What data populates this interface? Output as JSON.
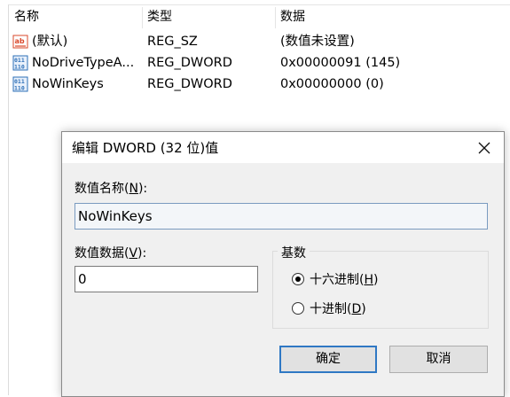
{
  "list": {
    "columns": [
      "名称",
      "类型",
      "数据"
    ],
    "rows": [
      {
        "icon": "string-value-icon",
        "name": "(默认)",
        "type": "REG_SZ",
        "data": "(数值未设置)"
      },
      {
        "icon": "dword-value-icon",
        "name": "NoDriveTypeA...",
        "type": "REG_DWORD",
        "data": "0x00000091 (145)"
      },
      {
        "icon": "dword-value-icon",
        "name": "NoWinKeys",
        "type": "REG_DWORD",
        "data": "0x00000000 (0)"
      }
    ]
  },
  "dialog": {
    "title": "编辑 DWORD (32 位)值",
    "value_name_label": "数值名称(",
    "value_name_key": "N",
    "value_name_suffix": "):",
    "value_name": "NoWinKeys",
    "value_data_label": "数值数据(",
    "value_data_key": "V",
    "value_data_suffix": "):",
    "value_data": "0",
    "base_label": "基数",
    "hex_label": "十六进制(",
    "hex_key": "H",
    "hex_suffix": ")",
    "dec_label": "十进制(",
    "dec_key": "D",
    "dec_suffix": ")",
    "base_selected": "hex",
    "ok_label": "确定",
    "cancel_label": "取消"
  },
  "colors": {
    "accent": "#2f78c4",
    "dialog_bg": "#f0f0f0",
    "string_icon": "#d9482b",
    "dword_icon": "#2d6fb7"
  }
}
